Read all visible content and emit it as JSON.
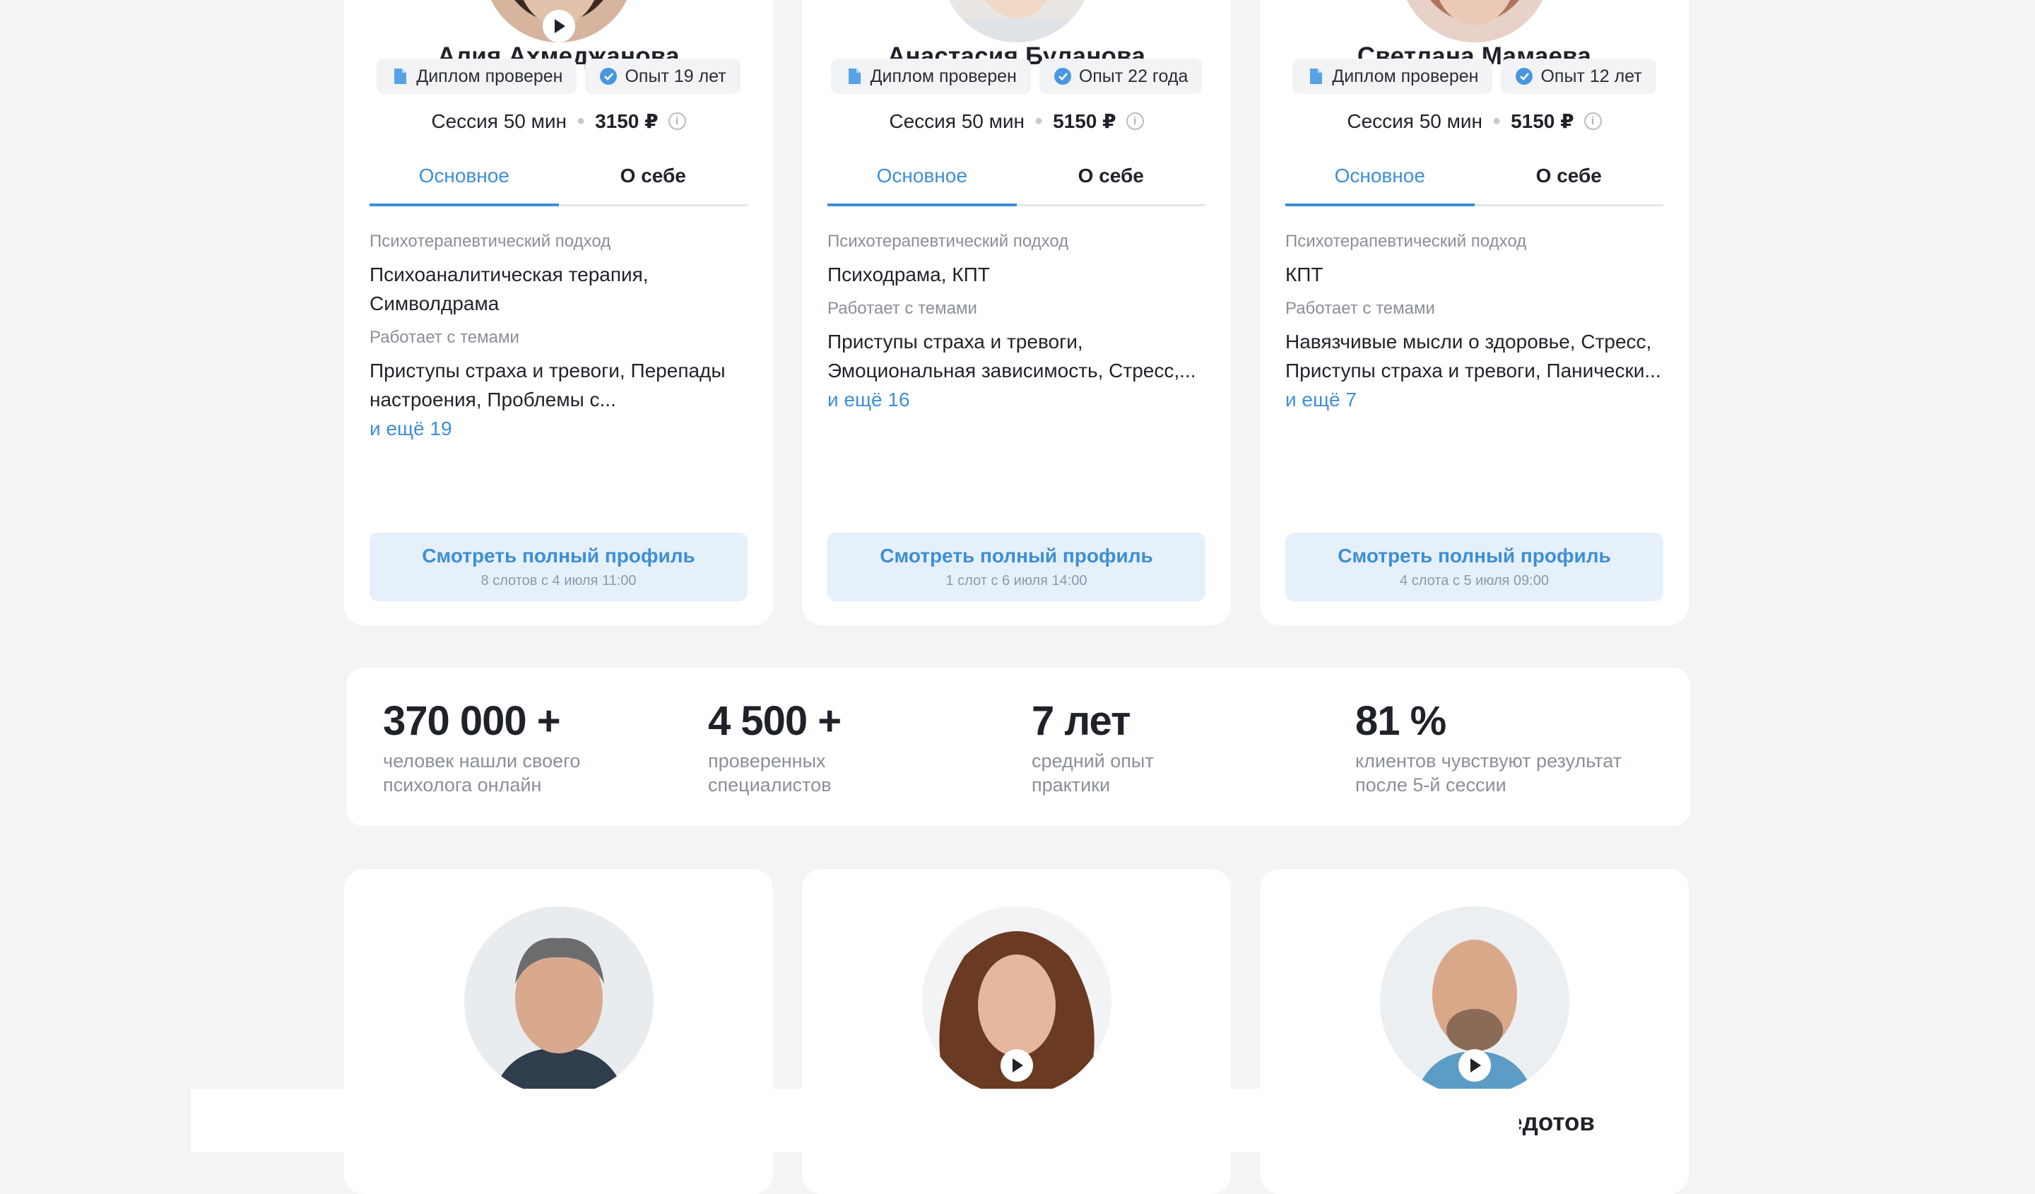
{
  "common": {
    "diploma": "Диплом проверен",
    "tab_main": "Основное",
    "tab_about": "О себе",
    "approach_label": "Психотерапевтический подход",
    "topics_label": "Работает с темами",
    "cta_label": "Смотреть полный профиль"
  },
  "cards": [
    {
      "name": "Алия Ахмеджанова",
      "experience": "Опыт 19 лет",
      "session": "Сессия 50 мин",
      "price": "3150 ₽",
      "approach": "Психоаналитическая терапия, Символдрама",
      "topics": "Приступы страха и тревоги, Перепады настроения, Проблемы с...",
      "more": "и ещё 19",
      "slots": "8 слотов с 4 июля 11:00"
    },
    {
      "name": "Анастасия Буланова",
      "experience": "Опыт 22 года",
      "session": "Сессия 50 мин",
      "price": "5150 ₽",
      "approach": "Психодрама, КПТ",
      "topics": "Приступы страха и тревоги, Эмоциональная зависимость, Стресс,...",
      "more": "и ещё 16",
      "slots": "1 слот с 6 июля 14:00"
    },
    {
      "name": "Светлана Мамаева",
      "experience": "Опыт 12 лет",
      "session": "Сессия 50 мин",
      "price": "5150 ₽",
      "approach": "КПТ",
      "topics": "Навязчивые мысли о здоровье, Стресс, Приступы страха и тревоги, Панически...",
      "more": "и ещё 7",
      "slots": "4 слота с 5 июля 09:00"
    }
  ],
  "stats": [
    {
      "value": "370 000 +",
      "desc_1": "человек нашли своего",
      "desc_2": "психолога онлайн"
    },
    {
      "value": "4 500 +",
      "desc_1": "проверенных",
      "desc_2": "специалистов"
    },
    {
      "value": "7 лет",
      "desc_1": "средний опыт",
      "desc_2": "практики"
    },
    {
      "value": "81 %",
      "desc_1": "клиентов чувствуют результат",
      "desc_2": "после 5-й сессии"
    }
  ],
  "bottom_cards": [
    {
      "name": ""
    },
    {
      "name": ""
    },
    {
      "name": "Владимир Федотов"
    }
  ]
}
